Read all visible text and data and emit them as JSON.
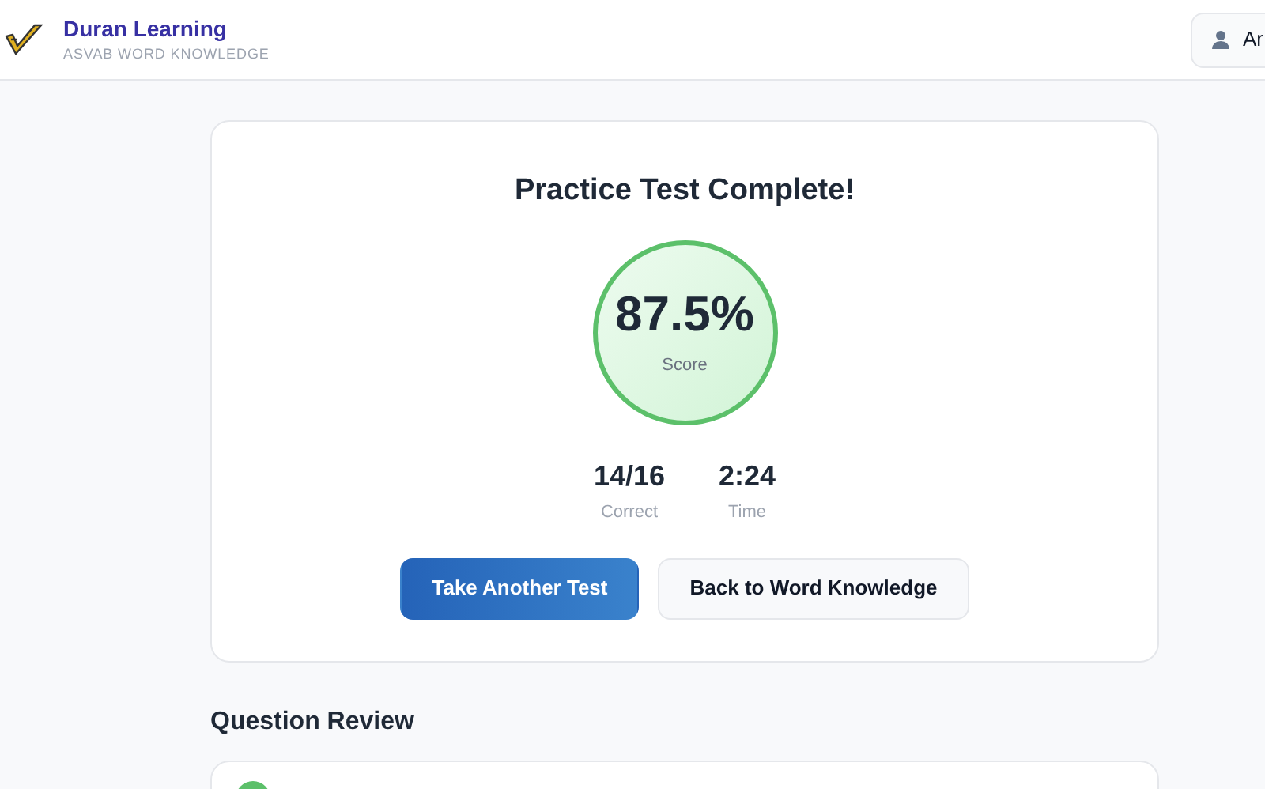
{
  "header": {
    "brand": "Duran Learning",
    "subtitle": "ASVAB WORD KNOWLEDGE",
    "user_button": "Ar"
  },
  "result": {
    "title": "Practice Test Complete!",
    "score": "87.5%",
    "score_label": "Score",
    "stats": [
      {
        "value": "14/16",
        "label": "Correct"
      },
      {
        "value": "2:24",
        "label": "Time"
      }
    ],
    "buttons": [
      {
        "label": "Take Another Test",
        "kind": "primary"
      },
      {
        "label": "Back to Word Knowledge",
        "kind": "secondary"
      }
    ]
  },
  "review": {
    "title": "Question Review",
    "items": [
      {
        "correct": true
      }
    ]
  }
}
